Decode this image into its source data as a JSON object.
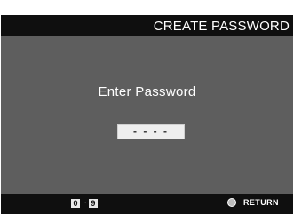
{
  "header": {
    "title": "CREATE PASSWORD"
  },
  "main": {
    "prompt": "Enter Password",
    "password_mask": "- - - -"
  },
  "footer": {
    "key_range": {
      "from": "0",
      "separator": "~",
      "to": "9"
    },
    "return_label": "RETURN",
    "return_icon": "circle-button-icon"
  },
  "colors": {
    "bar_background": "#0f0f0f",
    "panel_background": "#5e5e5e",
    "field_background": "#eeeeee",
    "text": "#ffffff"
  }
}
